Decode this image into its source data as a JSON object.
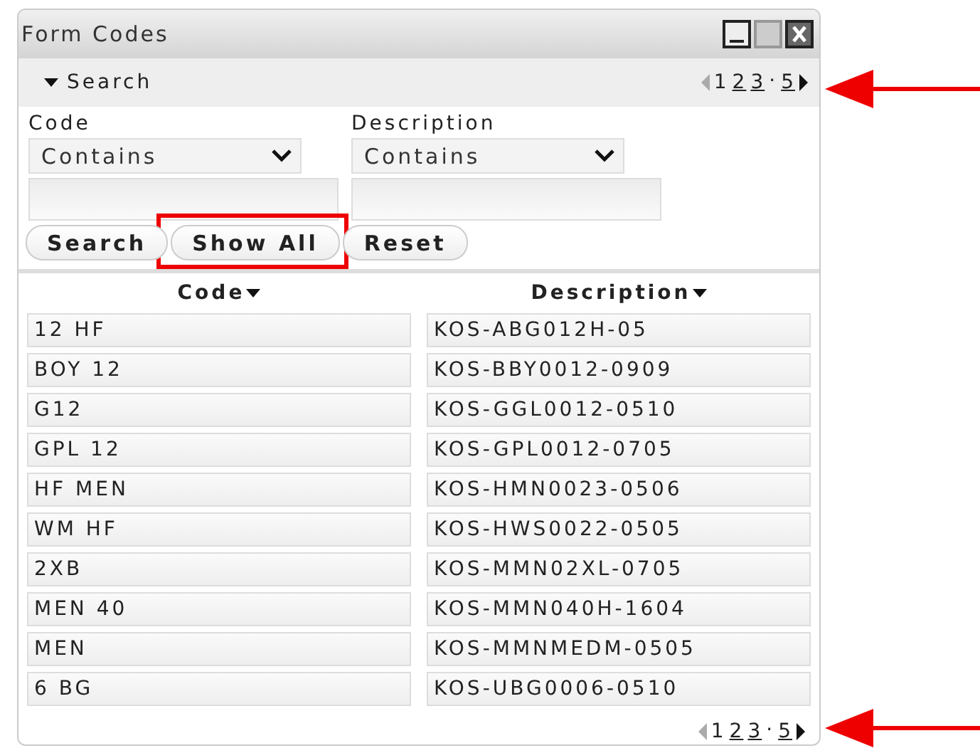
{
  "window": {
    "title": "Form Codes",
    "controls": [
      {
        "kind": "minimize",
        "disabled": false
      },
      {
        "kind": "maximize",
        "disabled": true
      },
      {
        "kind": "close",
        "disabled": false
      }
    ]
  },
  "search_panel": {
    "label": "Search",
    "expanded": true
  },
  "pager_top": {
    "prev_disabled": true,
    "next_disabled": false,
    "items": [
      {
        "kind": "page",
        "label": "1",
        "selected": true
      },
      {
        "kind": "page",
        "label": "2",
        "selected": false
      },
      {
        "kind": "page",
        "label": "3",
        "selected": false
      },
      {
        "kind": "gap",
        "label": "."
      },
      {
        "kind": "page",
        "label": "5",
        "selected": false
      }
    ]
  },
  "filters": [
    {
      "label": "Code",
      "operator": "Contains"
    },
    {
      "label": "Description",
      "operator": "Contains"
    }
  ],
  "buttons": [
    {
      "label": "Search",
      "highlighted": false
    },
    {
      "label": "Show All",
      "highlighted": true
    },
    {
      "label": "Reset",
      "highlighted": false
    }
  ],
  "table": {
    "columns": [
      "Code",
      "Description"
    ],
    "rows": [
      [
        "12 HF",
        "KOS-ABG012H-05"
      ],
      [
        "BOY 12",
        "KOS-BBY0012-0909"
      ],
      [
        "G12",
        "KOS-GGL0012-0510"
      ],
      [
        "GPL 12",
        "KOS-GPL0012-0705"
      ],
      [
        "HF MEN",
        "KOS-HMN0023-0506"
      ],
      [
        "WM HF",
        "KOS-HWS0022-0505"
      ],
      [
        "2XB",
        "KOS-MMN02XL-0705"
      ],
      [
        "MEN 40",
        "KOS-MMN040H-1604"
      ],
      [
        "MEN",
        "KOS-MMNMEDM-0505"
      ],
      [
        "6 BG",
        "KOS-UBG0006-0510"
      ]
    ]
  },
  "pager_bottom": {
    "prev_disabled": true,
    "next_disabled": false,
    "items": [
      {
        "kind": "page",
        "label": "1",
        "selected": true
      },
      {
        "kind": "page",
        "label": "2",
        "selected": false
      },
      {
        "kind": "page",
        "label": "3",
        "selected": false
      },
      {
        "kind": "gap",
        "label": "."
      },
      {
        "kind": "page",
        "label": "5",
        "selected": false
      }
    ]
  },
  "annotations": {
    "arrows_at_pagers": true
  }
}
